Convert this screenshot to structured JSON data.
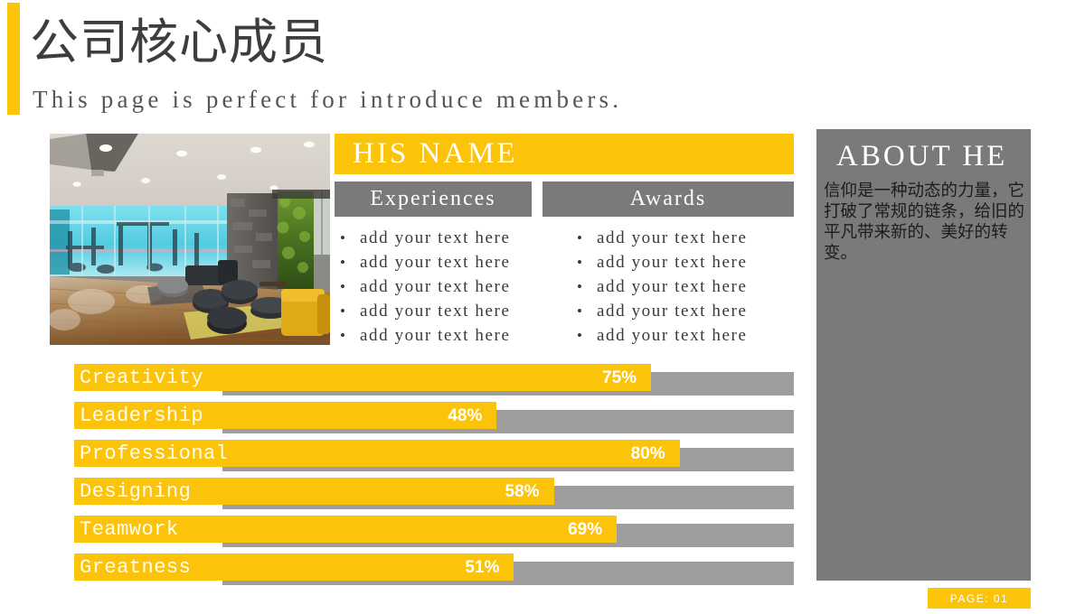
{
  "header": {
    "title_cn": "公司核心成员",
    "subtitle_en": "This page is perfect for introduce members.",
    "accent_color": "#fcc30b",
    "title_color": "#3d3d3d"
  },
  "photo": {
    "alt": "modern office lounge interior with wooden floor, teal glass gym area, dark ottomans and a yellow armchair"
  },
  "profile": {
    "name": "HIS NAME",
    "tabs": [
      {
        "label": "Experiences"
      },
      {
        "label": "Awards"
      }
    ],
    "experiences": [
      "add your text here",
      "add your text here",
      "add your text here",
      "add your text here",
      "add your text here"
    ],
    "awards": [
      "add your text here",
      "add your text here",
      "add your text here",
      "add your text here",
      "add your text here"
    ]
  },
  "about": {
    "title": "ABOUT HE",
    "body": "信仰是一种动态的力量，它打破了常规的链条，给旧的平凡带来新的、美好的转变。",
    "panel_color": "#7a7a7a"
  },
  "chart_data": {
    "type": "bar",
    "title": "",
    "orientation": "horizontal",
    "categories": [
      "Creativity",
      "Leadership",
      "Professional",
      "Designing",
      "Teamwork",
      "Greatness"
    ],
    "values": [
      75,
      48,
      80,
      58,
      69,
      51
    ],
    "value_labels": [
      "75%",
      "48%",
      "80%",
      "58%",
      "69%",
      "51%"
    ],
    "xlabel": "",
    "ylabel": "",
    "xlim": [
      0,
      100
    ],
    "grid": false,
    "legend": false,
    "bar_color": "#fcc30b",
    "track_color": "#9e9e9e"
  },
  "footer": {
    "page_label": "PAGE: 01",
    "badge_color": "#fcc30b"
  }
}
